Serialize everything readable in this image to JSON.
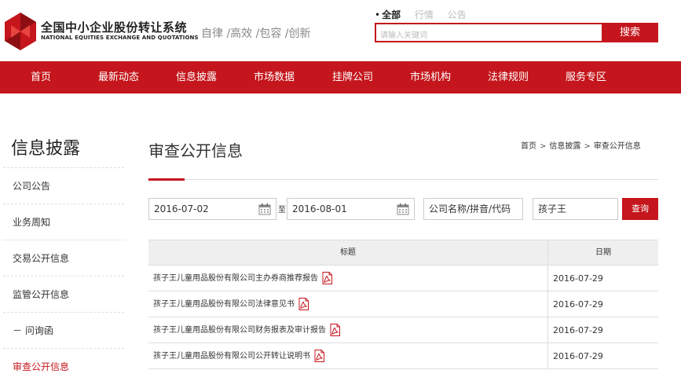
{
  "header": {
    "logo_cn": "全国中小企业股份转让系统",
    "logo_en": "NATIONAL EQUITIES EXCHANGE AND QUOTATIONS",
    "slogan": "自律 /高效 /包容 /创新",
    "search_tabs": [
      "全部",
      "行情",
      "公告"
    ],
    "search_placeholder": "请输入关键词",
    "search_button": "搜索"
  },
  "nav": {
    "items": [
      "首页",
      "最新动态",
      "信息披露",
      "市场数据",
      "挂牌公司",
      "市场机构",
      "法律规则",
      "服务专区"
    ]
  },
  "sidebar": {
    "title": "信息披露",
    "items": [
      {
        "label": "公司公告"
      },
      {
        "label": "业务周知"
      },
      {
        "label": "交易公开信息"
      },
      {
        "label": "监管公开信息"
      },
      {
        "label": "－  问询函"
      },
      {
        "label": "审查公开信息"
      }
    ],
    "active_index": 5
  },
  "main": {
    "title": "审查公开信息",
    "breadcrumb": [
      "首页",
      "信息披露",
      "审查公开信息"
    ],
    "breadcrumb_sep": ">",
    "filters": {
      "start_date": "2016-07-02",
      "to_label": "至",
      "end_date": "2016-08-01",
      "company_field": "公司名称/拼音/代码",
      "keyword": "孩子王",
      "query_button": "查询"
    },
    "table": {
      "headers": [
        "标题",
        "日期"
      ],
      "rows": [
        {
          "title": "孩子王儿童用品股份有限公司主办券商推荐报告",
          "date": "2016-07-29"
        },
        {
          "title": "孩子王儿童用品股份有限公司法律意见书",
          "date": "2016-07-29"
        },
        {
          "title": "孩子王儿童用品股份有限公司财务报表及审计报告",
          "date": "2016-07-29"
        },
        {
          "title": "孩子王儿童用品股份有限公司公开转让说明书",
          "date": "2016-07-29"
        }
      ]
    }
  },
  "colors": {
    "brand_red": "#c4161c",
    "header_bg": "#ffffff",
    "table_head_bg": "#efefef"
  },
  "icons": {
    "calendar": "calendar-icon",
    "pdf": "pdf-icon"
  }
}
